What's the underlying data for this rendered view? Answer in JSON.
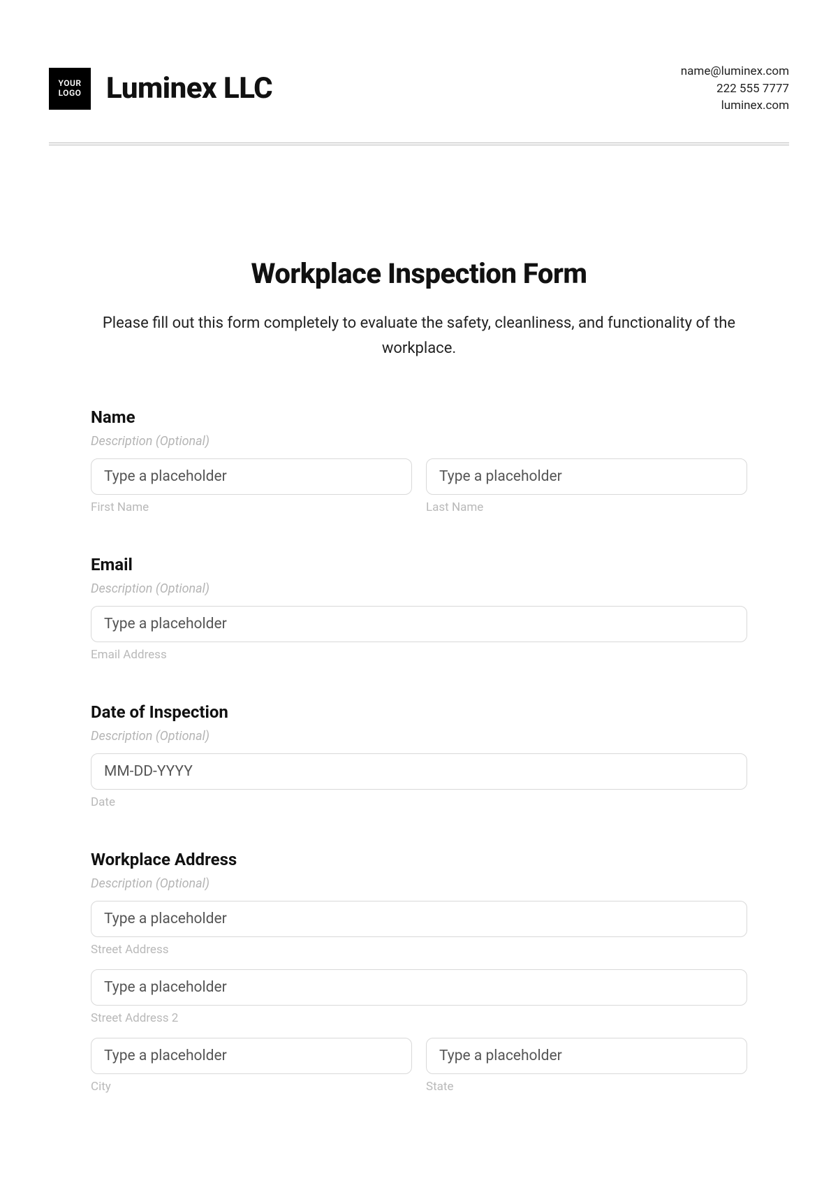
{
  "header": {
    "logo_line1": "YOUR",
    "logo_line2": "LOGO",
    "company": "Luminex LLC",
    "contact": {
      "email": "name@luminex.com",
      "phone": "222 555 7777",
      "website": "luminex.com"
    }
  },
  "title": "Workplace Inspection Form",
  "subtitle": "Please fill out this form completely to evaluate the safety, cleanliness, and functionality of the workplace.",
  "common": {
    "desc_optional": "Description (Optional)",
    "placeholder": "Type a placeholder"
  },
  "sections": {
    "name": {
      "label": "Name",
      "first_sub": "First Name",
      "last_sub": "Last Name"
    },
    "email": {
      "label": "Email",
      "sub": "Email Address"
    },
    "date": {
      "label": "Date of Inspection",
      "placeholder": "MM-DD-YYYY",
      "sub": "Date"
    },
    "address": {
      "label": "Workplace Address",
      "street_sub": "Street Address",
      "street2_sub": "Street Address 2",
      "city_sub": "City",
      "state_sub": "State"
    }
  }
}
